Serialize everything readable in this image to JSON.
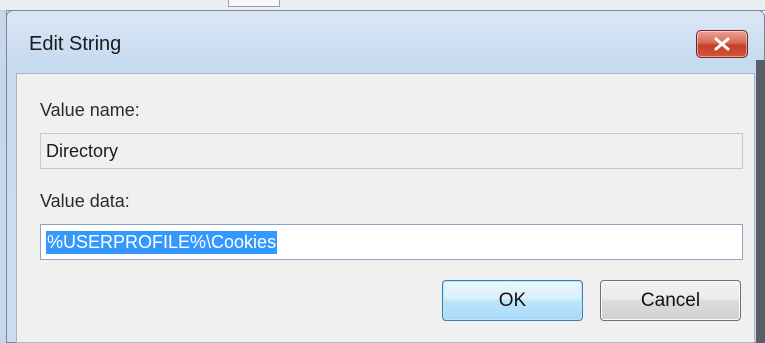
{
  "window": {
    "title": "Edit String",
    "close_icon": "close-icon"
  },
  "form": {
    "value_name_label": "Value name:",
    "value_name": "Directory",
    "value_data_label": "Value data:",
    "value_data": "%USERPROFILE%\\Cookies",
    "value_data_selected": true
  },
  "buttons": {
    "ok_label": "OK",
    "cancel_label": "Cancel"
  },
  "colors": {
    "selection": "#3399ff",
    "close_button": "#c4402b",
    "frame": "#cadcf0"
  }
}
